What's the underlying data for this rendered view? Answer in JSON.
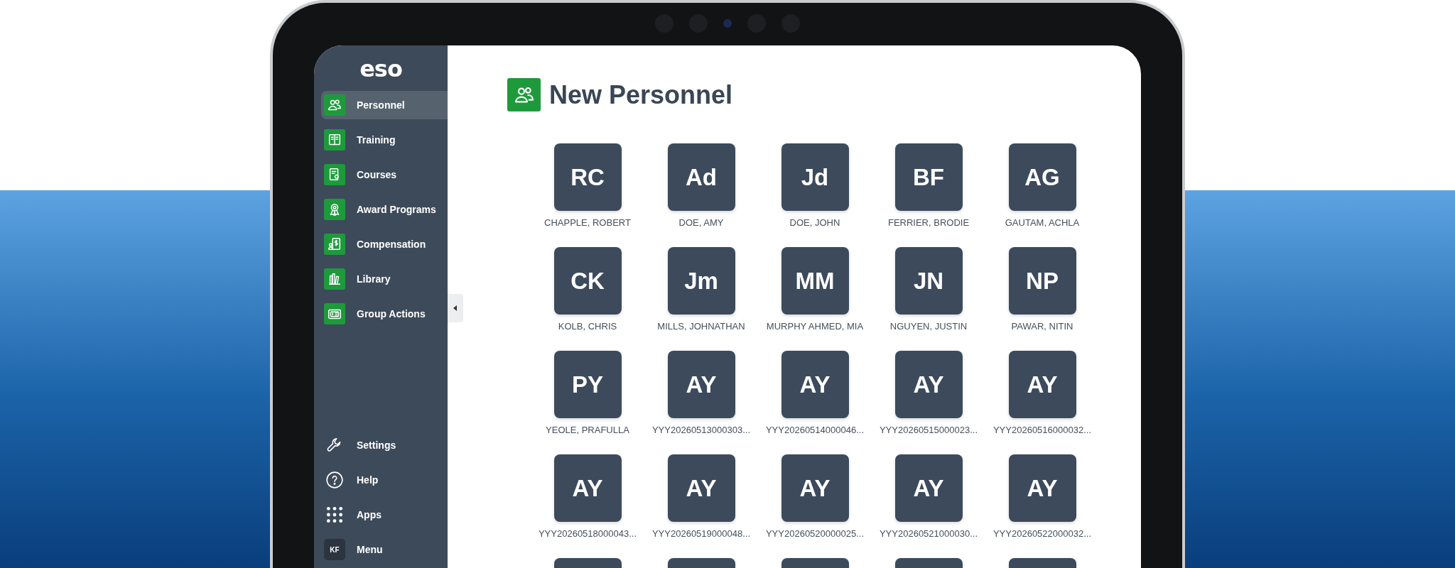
{
  "sidebar": {
    "logo": "eso",
    "nav_items": [
      {
        "label": "Personnel",
        "selected": true
      },
      {
        "label": "Training",
        "selected": false
      },
      {
        "label": "Courses",
        "selected": false
      },
      {
        "label": "Award Programs",
        "selected": false
      },
      {
        "label": "Compensation",
        "selected": false
      },
      {
        "label": "Library",
        "selected": false
      },
      {
        "label": "Group Actions",
        "selected": false
      }
    ],
    "footer_items": [
      {
        "kind": "settings",
        "label": "Settings"
      },
      {
        "kind": "help",
        "label": "Help"
      },
      {
        "kind": "apps",
        "label": "Apps"
      },
      {
        "kind": "user",
        "label": "Menu",
        "initials": "KF"
      }
    ]
  },
  "page": {
    "title": "New Personnel",
    "personnel": [
      {
        "initials": "RC",
        "name": "CHAPPLE, ROBERT"
      },
      {
        "initials": "Ad",
        "name": "DOE, AMY"
      },
      {
        "initials": "Jd",
        "name": "DOE, JOHN"
      },
      {
        "initials": "BF",
        "name": "FERRIER, BRODIE"
      },
      {
        "initials": "AG",
        "name": "GAUTAM, ACHLA"
      },
      {
        "initials": "CK",
        "name": "KOLB, CHRIS"
      },
      {
        "initials": "Jm",
        "name": "MILLS, JOHNATHAN"
      },
      {
        "initials": "MM",
        "name": "MURPHY AHMED, MIA"
      },
      {
        "initials": "JN",
        "name": "NGUYEN, JUSTIN"
      },
      {
        "initials": "NP",
        "name": "PAWAR, NITIN"
      },
      {
        "initials": "PY",
        "name": "YEOLE, PRAFULLA"
      },
      {
        "initials": "AY",
        "name": "YYY20260513000303..."
      },
      {
        "initials": "AY",
        "name": "YYY20260514000046..."
      },
      {
        "initials": "AY",
        "name": "YYY20260515000023..."
      },
      {
        "initials": "AY",
        "name": "YYY20260516000032..."
      },
      {
        "initials": "AY",
        "name": "YYY20260518000043..."
      },
      {
        "initials": "AY",
        "name": "YYY20260519000048..."
      },
      {
        "initials": "AY",
        "name": "YYY20260520000025..."
      },
      {
        "initials": "AY",
        "name": "YYY20260521000030..."
      },
      {
        "initials": "AY",
        "name": "YYY20260522000032..."
      }
    ]
  }
}
